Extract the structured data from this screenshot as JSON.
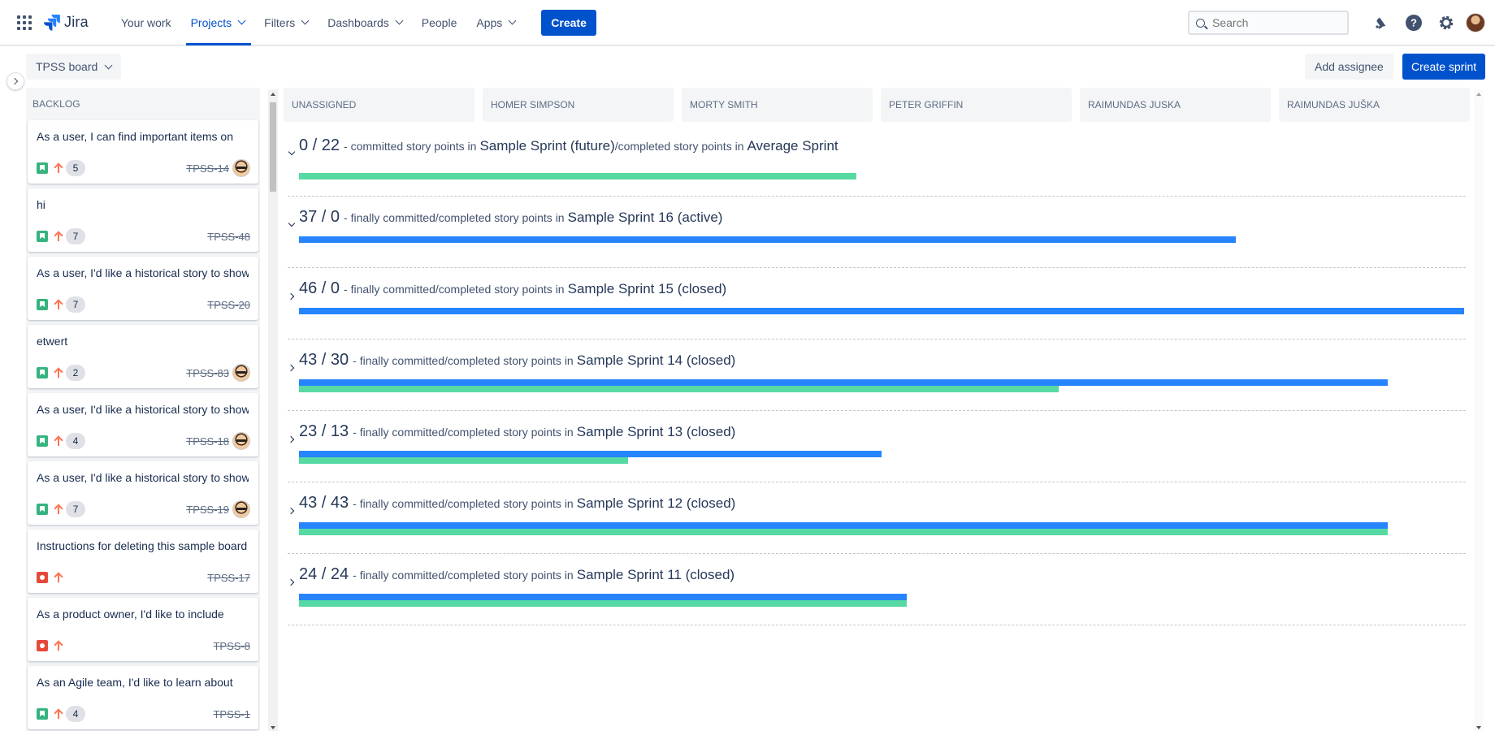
{
  "nav": {
    "logo": "Jira",
    "items": [
      {
        "label": "Your work",
        "dropdown": false,
        "active": false
      },
      {
        "label": "Projects",
        "dropdown": true,
        "active": true
      },
      {
        "label": "Filters",
        "dropdown": true,
        "active": false
      },
      {
        "label": "Dashboards",
        "dropdown": true,
        "active": false
      },
      {
        "label": "People",
        "dropdown": false,
        "active": false
      },
      {
        "label": "Apps",
        "dropdown": true,
        "active": false
      }
    ],
    "create_label": "Create",
    "search_placeholder": "Search",
    "icons": [
      "notification-icon",
      "help-icon",
      "settings-icon",
      "profile-avatar"
    ]
  },
  "toolbar": {
    "board_label": "TPSS board",
    "add_assignee_label": "Add assignee",
    "create_sprint_label": "Create sprint"
  },
  "backlog": {
    "title": "BACKLOG",
    "cards": [
      {
        "title": "As a user, I can find important items on",
        "type": "story",
        "points": "5",
        "key": "TPSS-14",
        "avatar": true
      },
      {
        "title": "hi",
        "type": "story",
        "points": "7",
        "key": "TPSS-48",
        "avatar": false
      },
      {
        "title": "As a user, I'd like a historical story to show",
        "type": "story",
        "points": "7",
        "key": "TPSS-20",
        "avatar": false
      },
      {
        "title": "etwert",
        "type": "story",
        "points": "2",
        "key": "TPSS-83",
        "avatar": true
      },
      {
        "title": "As a user, I'd like a historical story to show",
        "type": "story",
        "points": "4",
        "key": "TPSS-18",
        "avatar": true
      },
      {
        "title": "As a user, I'd like a historical story to show",
        "type": "story",
        "points": "7",
        "key": "TPSS-19",
        "avatar": true
      },
      {
        "title": "Instructions for deleting this sample board",
        "type": "bug",
        "points": null,
        "key": "TPSS-17",
        "avatar": false
      },
      {
        "title": "As a product owner, I'd like to include",
        "type": "bug",
        "points": null,
        "key": "TPSS-8",
        "avatar": false
      },
      {
        "title": "As an Agile team, I'd like to learn about",
        "type": "story",
        "points": "4",
        "key": "TPSS-1",
        "avatar": false
      }
    ]
  },
  "assignee_columns": [
    "UNASSIGNED",
    "HOMER SIMPSON",
    "MORTY SMITH",
    "PETER GRIFFIN",
    "RAIMUNDAS JUSKA",
    "RAIMUNDAS JUŠKA"
  ],
  "sprints": [
    {
      "nums": "0 / 22",
      "desc": "- committed story points in",
      "name": "Sample Sprint (future)",
      "desc2": "/completed story points in",
      "name2": "Average Sprint",
      "expanded": true,
      "committed": 0,
      "completed": 22,
      "bars": "completed-only"
    },
    {
      "nums": "37 / 0",
      "desc": "- finally committed/completed story points in",
      "name": "Sample Sprint 16 (active)",
      "expanded": true,
      "committed": 37,
      "completed": 0
    },
    {
      "nums": "46 / 0",
      "desc": "- finally committed/completed story points in",
      "name": "Sample Sprint 15 (closed)",
      "expanded": false,
      "committed": 46,
      "completed": 0
    },
    {
      "nums": "43 / 30",
      "desc": "- finally committed/completed story points in",
      "name": "Sample Sprint 14 (closed)",
      "expanded": false,
      "committed": 43,
      "completed": 30
    },
    {
      "nums": "23 / 13",
      "desc": "- finally committed/completed story points in",
      "name": "Sample Sprint 13 (closed)",
      "expanded": false,
      "committed": 23,
      "completed": 13
    },
    {
      "nums": "43 / 43",
      "desc": "- finally committed/completed story points in",
      "name": "Sample Sprint 12 (closed)",
      "expanded": false,
      "committed": 43,
      "completed": 43
    },
    {
      "nums": "24 / 24",
      "desc": "- finally committed/completed story points in",
      "name": "Sample Sprint 11 (closed)",
      "expanded": false,
      "committed": 24,
      "completed": 24
    }
  ],
  "colors": {
    "brand": "#0052cc",
    "committed_bar": "#2684ff",
    "completed_bar": "#57d9a3"
  }
}
